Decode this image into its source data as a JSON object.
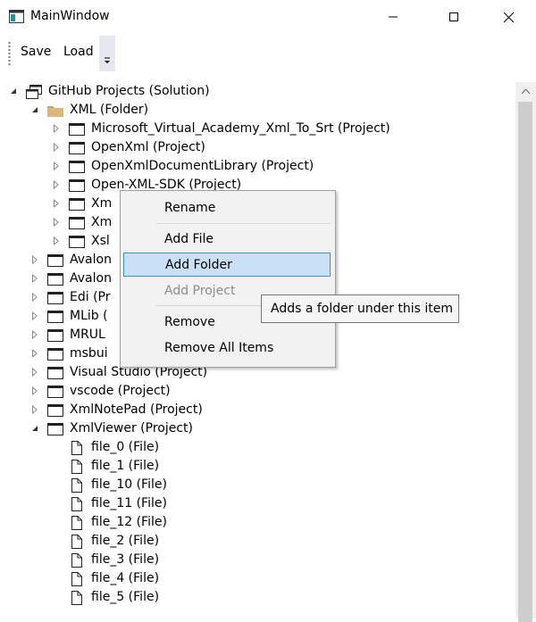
{
  "window": {
    "title": "MainWindow"
  },
  "toolbar": {
    "save_label": "Save",
    "load_label": "Load"
  },
  "tree": {
    "rows": [
      {
        "label": "GitHub Projects (Solution)",
        "icon": "solution-icon",
        "depth": 0,
        "arrow": "expanded"
      },
      {
        "label": "XML (Folder)",
        "icon": "folder-icon",
        "depth": 1,
        "arrow": "expanded"
      },
      {
        "label": "Microsoft_Virtual_Academy_Xml_To_Srt (Project)",
        "icon": "project-icon",
        "depth": 2,
        "arrow": "collapsed"
      },
      {
        "label": "OpenXml (Project)",
        "icon": "project-icon",
        "depth": 2,
        "arrow": "collapsed"
      },
      {
        "label": "OpenXmlDocumentLibrary (Project)",
        "icon": "project-icon",
        "depth": 2,
        "arrow": "collapsed"
      },
      {
        "label": "Open-XML-SDK (Project)",
        "icon": "project-icon",
        "depth": 2,
        "arrow": "collapsed"
      },
      {
        "label": "Xm",
        "icon": "project-icon",
        "depth": 2,
        "arrow": "collapsed"
      },
      {
        "label": "Xm",
        "icon": "project-icon",
        "depth": 2,
        "arrow": "collapsed"
      },
      {
        "label": "Xsl",
        "icon": "project-icon",
        "depth": 2,
        "arrow": "collapsed"
      },
      {
        "label": "Avalon",
        "icon": "project-icon",
        "depth": 1,
        "arrow": "collapsed"
      },
      {
        "label": "Avalon",
        "icon": "project-icon",
        "depth": 1,
        "arrow": "collapsed"
      },
      {
        "label": "Edi (Pr",
        "icon": "project-icon",
        "depth": 1,
        "arrow": "collapsed"
      },
      {
        "label": "MLib (",
        "icon": "project-icon",
        "depth": 1,
        "arrow": "collapsed"
      },
      {
        "label": "MRUL",
        "icon": "project-icon",
        "depth": 1,
        "arrow": "collapsed"
      },
      {
        "label": "msbui",
        "icon": "project-icon",
        "depth": 1,
        "arrow": "collapsed"
      },
      {
        "label": "Visual Studio (Project)",
        "icon": "project-icon",
        "depth": 1,
        "arrow": "collapsed"
      },
      {
        "label": "vscode (Project)",
        "icon": "project-icon",
        "depth": 1,
        "arrow": "collapsed"
      },
      {
        "label": "XmlNotePad (Project)",
        "icon": "project-icon",
        "depth": 1,
        "arrow": "collapsed"
      },
      {
        "label": "XmlViewer (Project)",
        "icon": "project-icon",
        "depth": 1,
        "arrow": "expanded"
      },
      {
        "label": "file_0 (File)",
        "icon": "file-icon",
        "depth": 2,
        "arrow": "none"
      },
      {
        "label": "file_1 (File)",
        "icon": "file-icon",
        "depth": 2,
        "arrow": "none"
      },
      {
        "label": "file_10 (File)",
        "icon": "file-icon",
        "depth": 2,
        "arrow": "none"
      },
      {
        "label": "file_11 (File)",
        "icon": "file-icon",
        "depth": 2,
        "arrow": "none"
      },
      {
        "label": "file_12 (File)",
        "icon": "file-icon",
        "depth": 2,
        "arrow": "none"
      },
      {
        "label": "file_2 (File)",
        "icon": "file-icon",
        "depth": 2,
        "arrow": "none"
      },
      {
        "label": "file_3 (File)",
        "icon": "file-icon",
        "depth": 2,
        "arrow": "none"
      },
      {
        "label": "file_4 (File)",
        "icon": "file-icon",
        "depth": 2,
        "arrow": "none"
      },
      {
        "label": "file_5 (File)",
        "icon": "file-icon",
        "depth": 2,
        "arrow": "none"
      }
    ]
  },
  "context_menu": {
    "items": [
      {
        "label": "Rename",
        "state": "normal"
      },
      {
        "label": "Add File",
        "state": "normal"
      },
      {
        "label": "Add Folder",
        "state": "highlighted"
      },
      {
        "label": "Add Project",
        "state": "disabled"
      },
      {
        "label": "Remove",
        "state": "normal"
      },
      {
        "label": "Remove All Items",
        "state": "normal"
      }
    ]
  },
  "tooltip": {
    "text": "Adds a folder under this item"
  },
  "colors": {
    "highlight_bg": "#c9e0f7",
    "highlight_border": "#3b8fd6",
    "folder": "#dcb67a"
  }
}
